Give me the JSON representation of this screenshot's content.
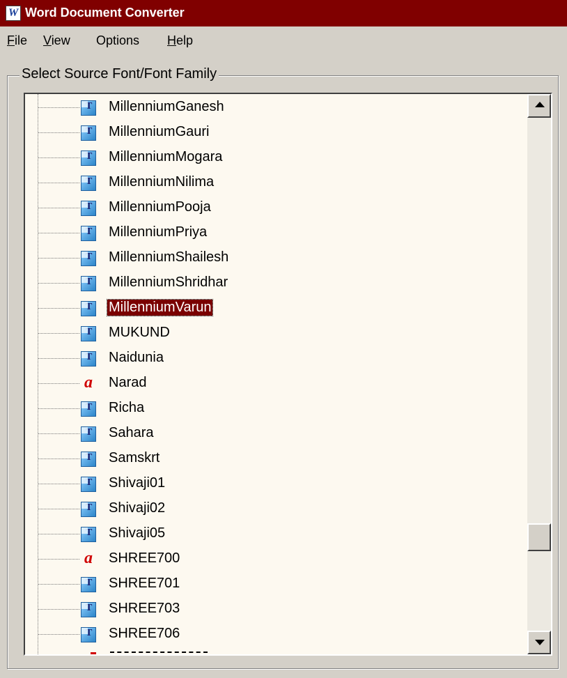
{
  "window": {
    "title": "Word Document Converter"
  },
  "menu": {
    "file": {
      "access": "F",
      "rest": "ile"
    },
    "view": {
      "access": "V",
      "rest": "iew"
    },
    "options": {
      "label": "Options"
    },
    "help": {
      "access": "H",
      "rest": "elp"
    }
  },
  "group": {
    "label": "Select Source Font/Font Family"
  },
  "font_list": {
    "items": [
      {
        "label": "MillenniumGanesh",
        "icon": "truetype-font-icon",
        "selected": false
      },
      {
        "label": "MillenniumGauri",
        "icon": "truetype-font-icon",
        "selected": false
      },
      {
        "label": "MillenniumMogara",
        "icon": "truetype-font-icon",
        "selected": false
      },
      {
        "label": "MillenniumNilima",
        "icon": "truetype-font-icon",
        "selected": false
      },
      {
        "label": "MillenniumPooja",
        "icon": "truetype-font-icon",
        "selected": false
      },
      {
        "label": "MillenniumPriya",
        "icon": "truetype-font-icon",
        "selected": false
      },
      {
        "label": "MillenniumShailesh",
        "icon": "truetype-font-icon",
        "selected": false
      },
      {
        "label": "MillenniumShridhar",
        "icon": "truetype-font-icon",
        "selected": false
      },
      {
        "label": "MillenniumVarun",
        "icon": "truetype-font-icon",
        "selected": true
      },
      {
        "label": "MUKUND",
        "icon": "truetype-font-icon",
        "selected": false
      },
      {
        "label": "Naidunia",
        "icon": "truetype-font-icon",
        "selected": false
      },
      {
        "label": "Narad",
        "icon": "type1-font-icon",
        "selected": false
      },
      {
        "label": "Richa",
        "icon": "truetype-font-icon",
        "selected": false
      },
      {
        "label": "Sahara",
        "icon": "truetype-font-icon",
        "selected": false
      },
      {
        "label": "Samskrt",
        "icon": "truetype-font-icon",
        "selected": false
      },
      {
        "label": "Shivaji01",
        "icon": "truetype-font-icon",
        "selected": false
      },
      {
        "label": "Shivaji02",
        "icon": "truetype-font-icon",
        "selected": false
      },
      {
        "label": "Shivaji05",
        "icon": "truetype-font-icon",
        "selected": false
      },
      {
        "label": "SHREE700",
        "icon": "type1-font-icon",
        "selected": false
      },
      {
        "label": "SHREE701",
        "icon": "truetype-font-icon",
        "selected": false
      },
      {
        "label": "SHREE703",
        "icon": "truetype-font-icon",
        "selected": false
      },
      {
        "label": "SHREE706",
        "icon": "truetype-font-icon",
        "selected": false
      }
    ],
    "selection_color": "#7a0000",
    "background_color": "#fdf9f0"
  },
  "colors": {
    "titlebar": "#800000",
    "face": "#d4d0c8"
  }
}
